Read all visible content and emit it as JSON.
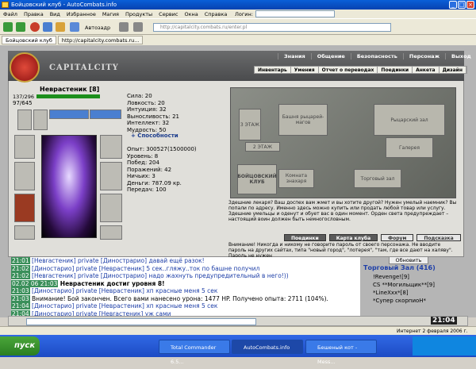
{
  "window": {
    "title": "Бойцовский клуб - AutoCombats.info"
  },
  "menu": {
    "items": [
      "Файл",
      "Правка",
      "Вид",
      "Избранное",
      "Магия",
      "Продукты",
      "Сервис",
      "Окна",
      "Справка"
    ],
    "login_label": "Логин:"
  },
  "toolbar": {
    "autofill": "Автозадр",
    "address": "http://capitalcity.combats.ru/enter.pl"
  },
  "tabs": [
    {
      "label": "Бойцовский клуб"
    },
    {
      "label": "http://capitalcity.combats.ru..."
    }
  ],
  "site": {
    "brand": "CAPITALCITY",
    "topnav": [
      "Знания",
      "Общение",
      "Безопасность",
      "Персонаж",
      "Выход"
    ],
    "subnav": [
      "Инвентарь",
      "Умения",
      "Отчет о переводах",
      "Поединки",
      "Анкета",
      "Дизайн"
    ]
  },
  "character": {
    "name": "Неврастеник [8]",
    "hp": "137/296",
    "mp": "97/645",
    "stats": [
      "Сила: 20",
      "Ловкость: 20",
      "Интуиция: 32",
      "Выносливость: 21",
      "Интеллект: 32",
      "Мудрость: 50"
    ],
    "abilities_label": "+ Способности",
    "stats2": [
      "Опыт: 300527(1500000)",
      "Уровень: 8",
      "Побед: 204",
      "Поражений: 42",
      "Ничьих: 3",
      "Деньги: 787.09 кр.",
      "Передач: 100"
    ]
  },
  "map": {
    "rooms": [
      "3 ЭТАЖ",
      "Башня рыцарей-магов",
      "Рыцарский зал",
      "2 ЭТАЖ",
      "Галерея",
      "БОЙЦОВСКИЙ КЛУБ",
      "Комната знахаря",
      "Торговый зал"
    ]
  },
  "description": "Здешние лекаря? Ваш доспех вам жмет и вы хотите другой? Нужен умелый наемник? Вы попали по адресу. Именно здесь можно купить или продать любой товар или услугу. Здешние умельцы и оденут и обует вас в один момент. Орден света предупреждает – настоящий воин должен быть немногословным.",
  "nav_buttons": [
    "Поединки",
    "Карта клуба",
    "Форум",
    "Подсказка"
  ],
  "warning": "Внимание! Никогда и никому не говорите пароль от своего персонажа. Не вводите пароль на других сайтах, типа \"новый город\", \"лотерея\", \"там, где все дают на халяву\". Пароль не нужен",
  "chat": [
    {
      "time": "21:01",
      "text": "[Невrастеник] private [Динострарио] давай ещё разок!"
    },
    {
      "time": "21:02",
      "text": "[Диностарио] private [Неврастеник] 5 сек..гляжу..ток по башне получил"
    },
    {
      "time": "21:02",
      "text": "[Невrастеник] private [Динострарио] надо жахнуть предупредительный в него!))"
    },
    {
      "time": "02.02 06 21:03",
      "text": "Неврастеник достиг уровня 8!"
    },
    {
      "time": "21:03",
      "text": "[Диностарио] private [Неврастеник] хп красные меня 5 сек"
    },
    {
      "time": "21:03",
      "text": "Внимание! Бой закончен. Всего вами нанесено урона: 1477 HP. Получено опыта: 2711 (104%)."
    },
    {
      "time": "21:04",
      "text": "[Диностарио] private [Неврастеник] хп красные меня 5 сек"
    },
    {
      "time": "21:04",
      "text": "[Диностарио] private [Невrастеник] уж сами"
    }
  ],
  "room": {
    "refresh_label": "Обновить",
    "title": "Торговый Зал (416)",
    "users": [
      "!Revenge![9]",
      "CS **Могильщик**[9]",
      "*LineXxx*[8]",
      "*Супер скорпиоН*"
    ]
  },
  "clock": "21:04",
  "status": {
    "zone": "Интернет",
    "date": "2 февраля 2006 г."
  },
  "taskbar": {
    "start": "пуск",
    "tasks": [
      "Total Commander 6.5...",
      "AutoCombats.info",
      "Бешеный кот - Mess..."
    ]
  }
}
